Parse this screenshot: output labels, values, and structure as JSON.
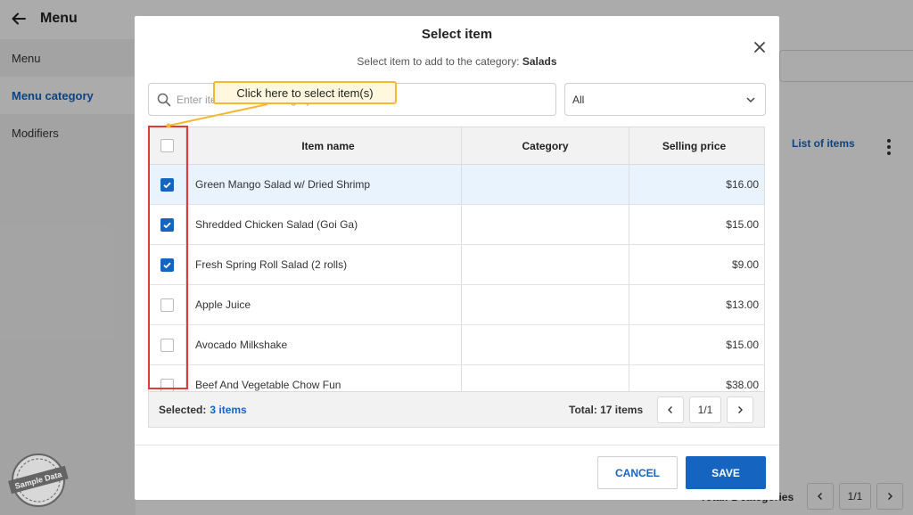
{
  "app": {
    "title": "Menu",
    "sidebar": [
      {
        "label": "Menu"
      },
      {
        "label": "Menu category"
      },
      {
        "label": "Modifiers"
      }
    ],
    "list_link": "List of items",
    "total_categories": "Total: 1 categories",
    "pager_page": "1/1"
  },
  "modal": {
    "title": "Select item",
    "subtitle_prefix": "Select item to add to the category:",
    "subtitle_category": "Salads",
    "search": {
      "placeholder": "Enter item name or category",
      "value": ""
    },
    "filter": {
      "selected": "All"
    },
    "columns": {
      "name": "Item name",
      "category": "Category",
      "price": "Selling price"
    },
    "rows": [
      {
        "name": "Green Mango Salad w/ Dried Shrimp",
        "category": "",
        "price": "$16.00",
        "checked": true
      },
      {
        "name": "Shredded Chicken Salad (Goi Ga)",
        "category": "",
        "price": "$15.00",
        "checked": true
      },
      {
        "name": "Fresh Spring Roll Salad (2 rolls)",
        "category": "",
        "price": "$9.00",
        "checked": true
      },
      {
        "name": "Apple Juice",
        "category": "",
        "price": "$13.00",
        "checked": false
      },
      {
        "name": "Avocado Milkshake",
        "category": "",
        "price": "$15.00",
        "checked": false
      },
      {
        "name": "Beef And Vegetable Chow Fun",
        "category": "",
        "price": "$38.00",
        "checked": false
      }
    ],
    "footer": {
      "selected_label": "Selected:",
      "selected_count": "3 items",
      "total": "Total: 17 items",
      "page": "1/1"
    },
    "cancel_label": "CANCEL",
    "save_label": "SAVE"
  },
  "annotation": {
    "callout": "Click here to select item(s)"
  },
  "watermark": "Sample Data",
  "colors": {
    "accent": "#1565c0",
    "highlight": "#e9f3fd",
    "annotation_red": "#e53935",
    "callout_border": "#f5b82e"
  }
}
